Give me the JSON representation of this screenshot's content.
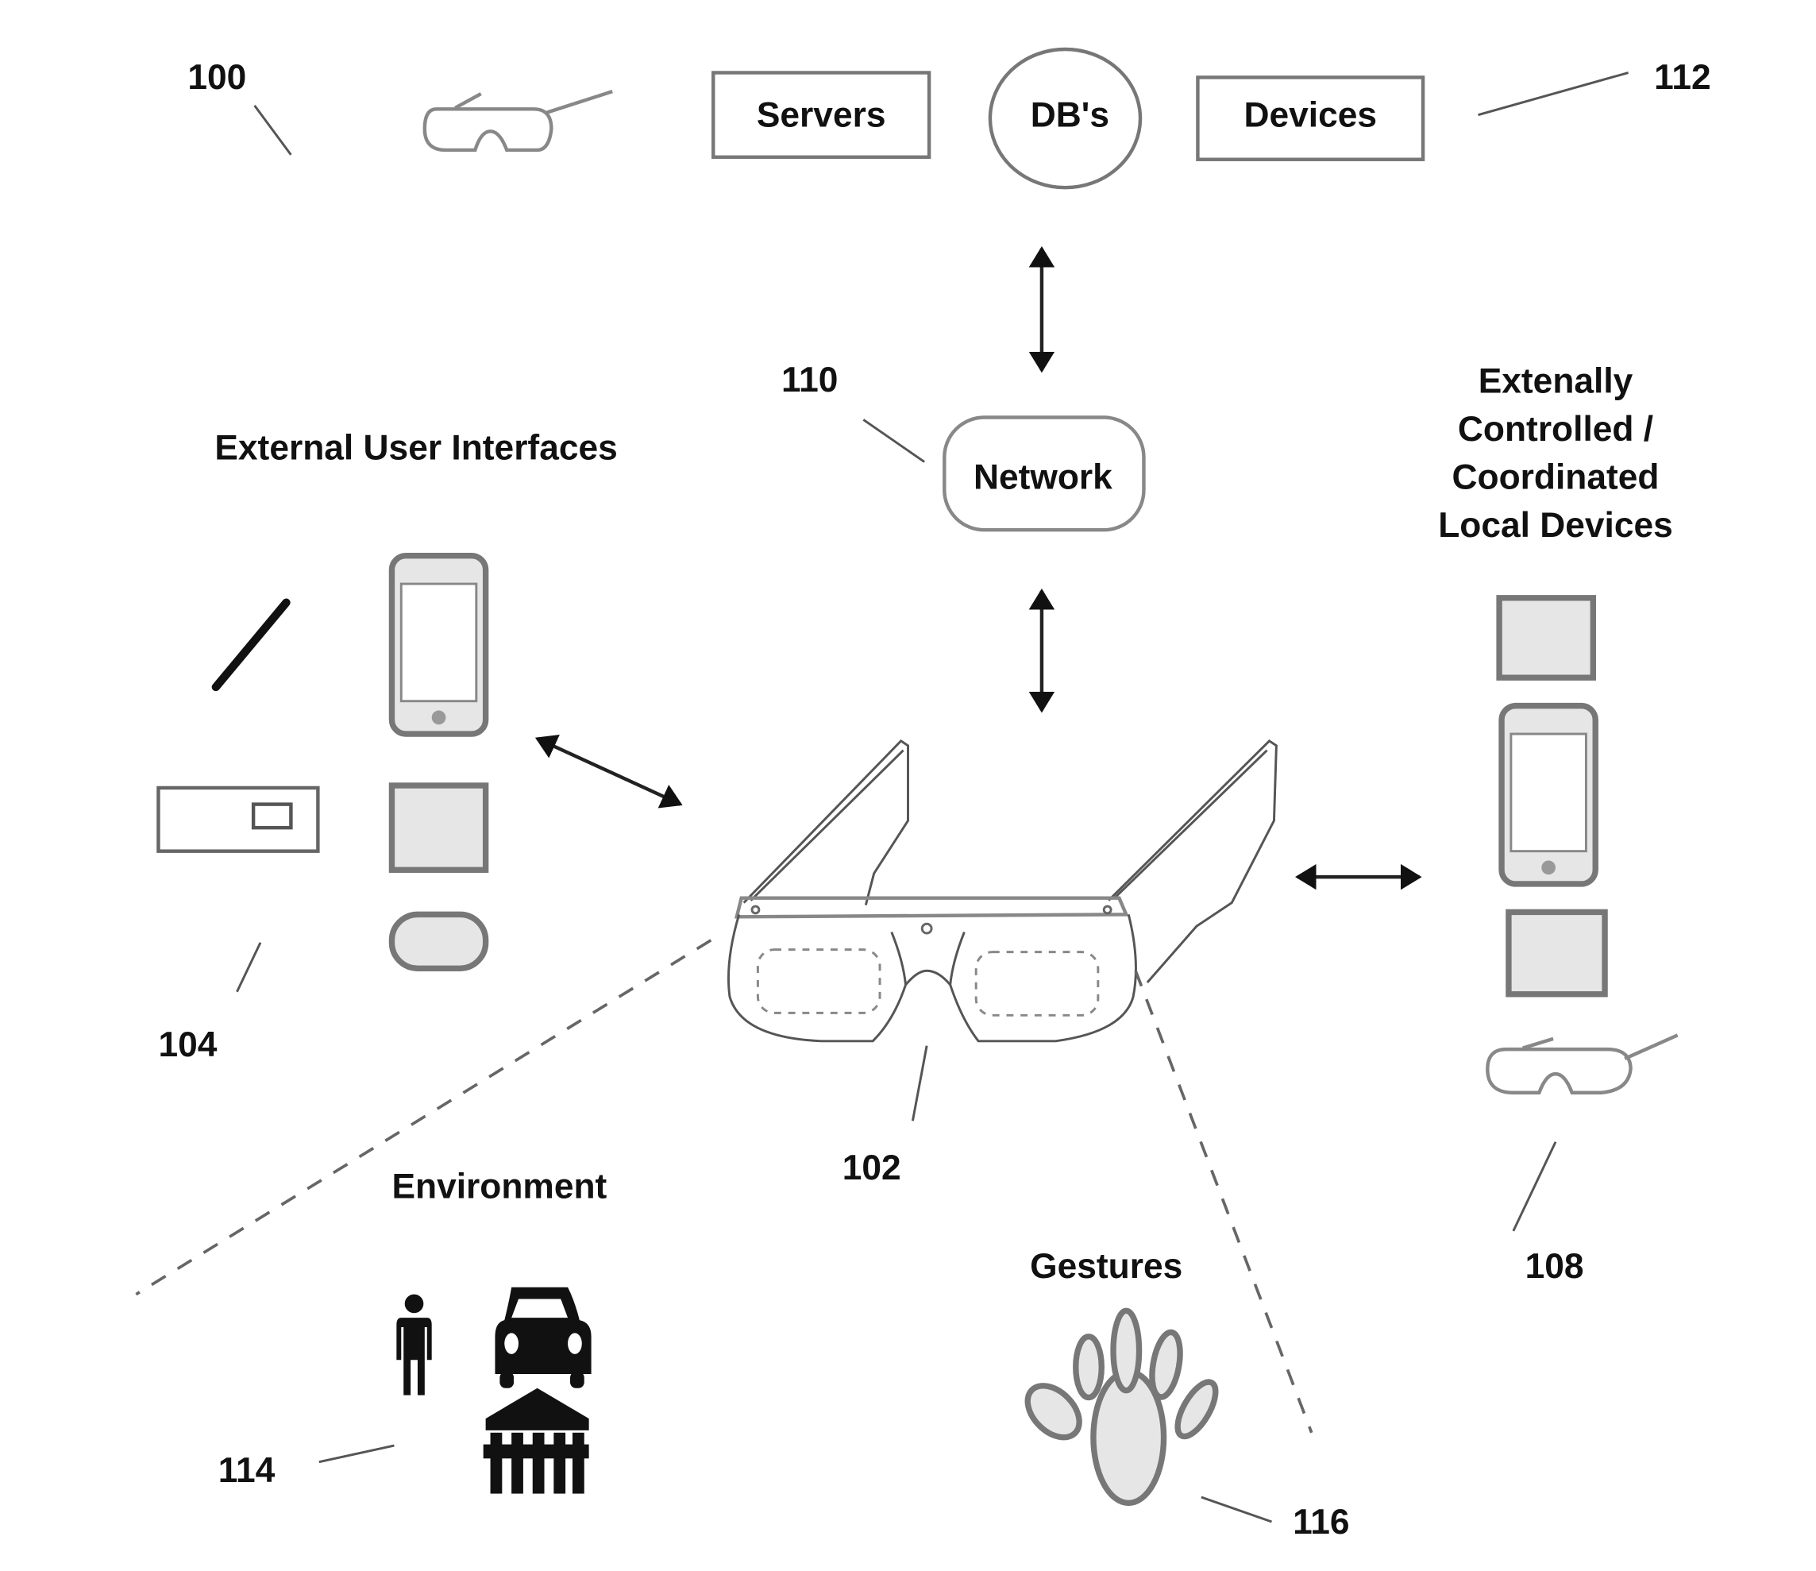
{
  "figure": {
    "reference_numbers": {
      "system": "100",
      "eyewear_device": "102",
      "external_user_interfaces": "104",
      "local_devices": "108",
      "network": "110",
      "remote_resources": "112",
      "environment": "114",
      "gestures": "116"
    },
    "nodes": {
      "servers": "Servers",
      "dbs": "DB's",
      "devices": "Devices",
      "network": "Network"
    },
    "section_labels": {
      "external_user_interfaces": "External User Interfaces",
      "local_devices_line1": "Extenally",
      "local_devices_line2": "Controlled /",
      "local_devices_line3": "Coordinated",
      "local_devices_line4": "Local Devices",
      "environment": "Environment",
      "gestures": "Gestures"
    },
    "icons": {
      "top_glasses": "glasses-icon",
      "main_glasses": "smart-glasses-icon",
      "ui_stylus": "stylus-icon",
      "ui_phone": "smartphone-icon",
      "ui_card": "card-reader-icon",
      "ui_square": "tablet-icon",
      "ui_oval": "wearable-band-icon",
      "local_square_top": "tablet-icon",
      "local_phone": "smartphone-icon",
      "local_square_bottom": "tablet-icon",
      "local_glasses": "glasses-icon",
      "env_person": "person-icon",
      "env_car": "car-icon",
      "env_building": "building-icon",
      "gesture_hand": "hand-icon"
    },
    "connections": [
      {
        "from": "Network",
        "to": "Servers/DB's/Devices",
        "type": "bidirectional"
      },
      {
        "from": "Network",
        "to": "Eyewear",
        "type": "bidirectional"
      },
      {
        "from": "External User Interfaces",
        "to": "Eyewear",
        "type": "bidirectional"
      },
      {
        "from": "Eyewear",
        "to": "Local Devices",
        "type": "bidirectional"
      },
      {
        "from": "Eyewear",
        "to": "Environment",
        "type": "dashed"
      },
      {
        "from": "Eyewear",
        "to": "Gestures",
        "type": "dashed"
      }
    ]
  }
}
